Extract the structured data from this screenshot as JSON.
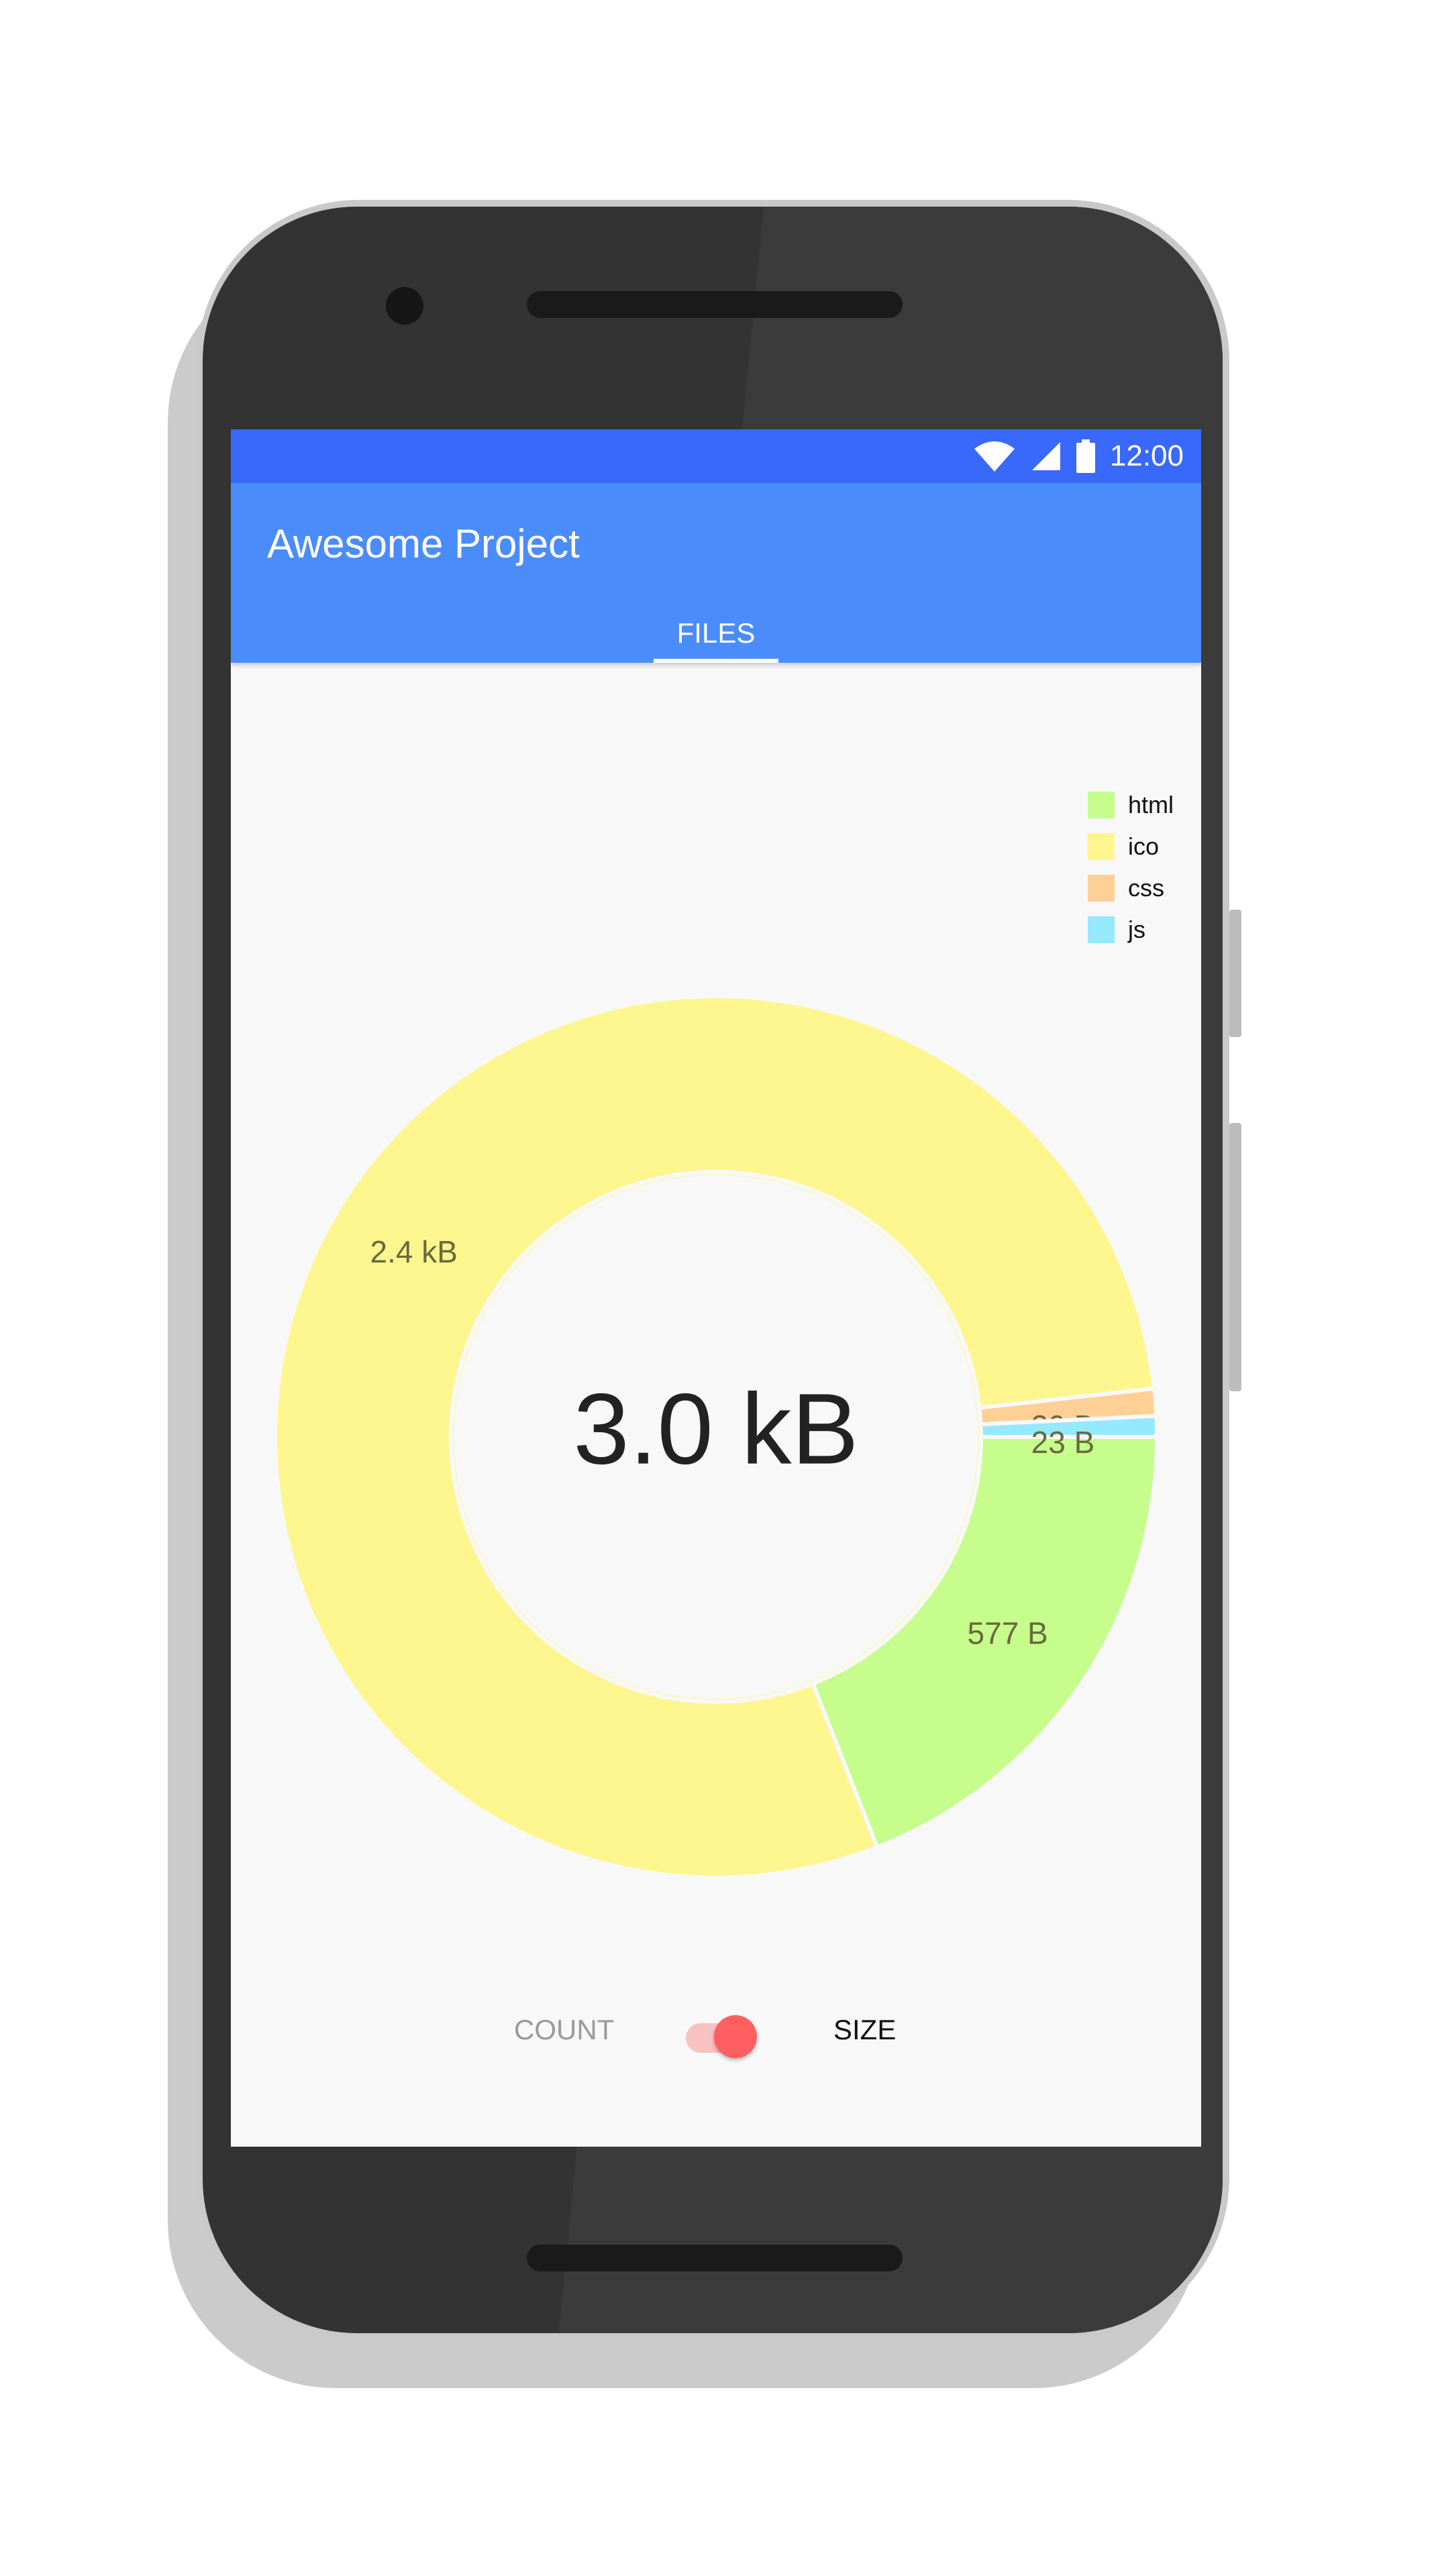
{
  "status_bar": {
    "time": "12:00",
    "icons": [
      "wifi-icon",
      "cellular-signal-icon",
      "battery-icon"
    ]
  },
  "app_bar": {
    "title": "Awesome Project",
    "tabs": [
      {
        "label": "FILES",
        "selected": true
      }
    ]
  },
  "colors": {
    "status_bar": "#3869fb",
    "app_bar": "#4b8cfb",
    "html": "#c6fd8c",
    "ico": "#fdf68f",
    "css": "#fed096",
    "js": "#95e9fd",
    "switch_thumb": "#ff5f5f",
    "switch_track": "#f7c2c2"
  },
  "legend": [
    {
      "label": "html",
      "color": "#c6fd8c"
    },
    {
      "label": "ico",
      "color": "#fdf68f"
    },
    {
      "label": "css",
      "color": "#fed096"
    },
    {
      "label": "js",
      "color": "#95e9fd"
    }
  ],
  "center_label": "3.0 kB",
  "toggle": {
    "left_label": "COUNT",
    "right_label": "SIZE",
    "selected": "SIZE"
  },
  "chart_data": {
    "type": "pie",
    "title": "",
    "total_label": "3.0 kB",
    "categories": [
      "html",
      "ico",
      "css",
      "js"
    ],
    "values": [
      577,
      2400,
      30,
      23
    ],
    "labels": [
      "577 B",
      "2.4 kB",
      "30 B",
      "23 B"
    ],
    "colors": [
      "#c6fd8c",
      "#fdf68f",
      "#fed096",
      "#95e9fd"
    ],
    "legend_position": "top-right"
  }
}
